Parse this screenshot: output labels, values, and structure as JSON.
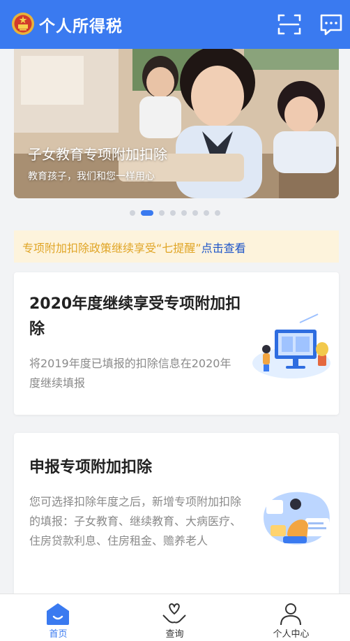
{
  "header": {
    "title": "个人所得税",
    "emblem_icon": "national-emblem-icon",
    "scan_icon": "scan-icon",
    "message_icon": "message-icon"
  },
  "banner": {
    "title": "子女教育专项附加扣除",
    "subtitle": "教育孩子，我们和您一样用心",
    "slide_count": 8,
    "active_slide": 2
  },
  "notice": {
    "text": "专项附加扣除政策继续享受“七提醒”",
    "link": "点击查看"
  },
  "cards": [
    {
      "title": "2020年度继续享受专项附加扣除",
      "description": "将2019年度已填报的扣除信息在2020年度继续填报"
    },
    {
      "title": "申报专项附加扣除",
      "description": "您可选择扣除年度之后，新增专项附加扣除的填报：子女教育、继续教育、大病医疗、住房贷款利息、住房租金、赡养老人"
    }
  ],
  "tabbar": {
    "items": [
      {
        "label": "首页",
        "icon": "home-icon",
        "active": true
      },
      {
        "label": "查询",
        "icon": "heart-hand-icon",
        "active": false
      },
      {
        "label": "个人中心",
        "icon": "person-icon",
        "active": false
      }
    ]
  },
  "colors": {
    "brand": "#3a7af0",
    "notice_bg": "#fdf3dc",
    "notice_text": "#e0a526",
    "notice_link": "#1e55c8"
  }
}
